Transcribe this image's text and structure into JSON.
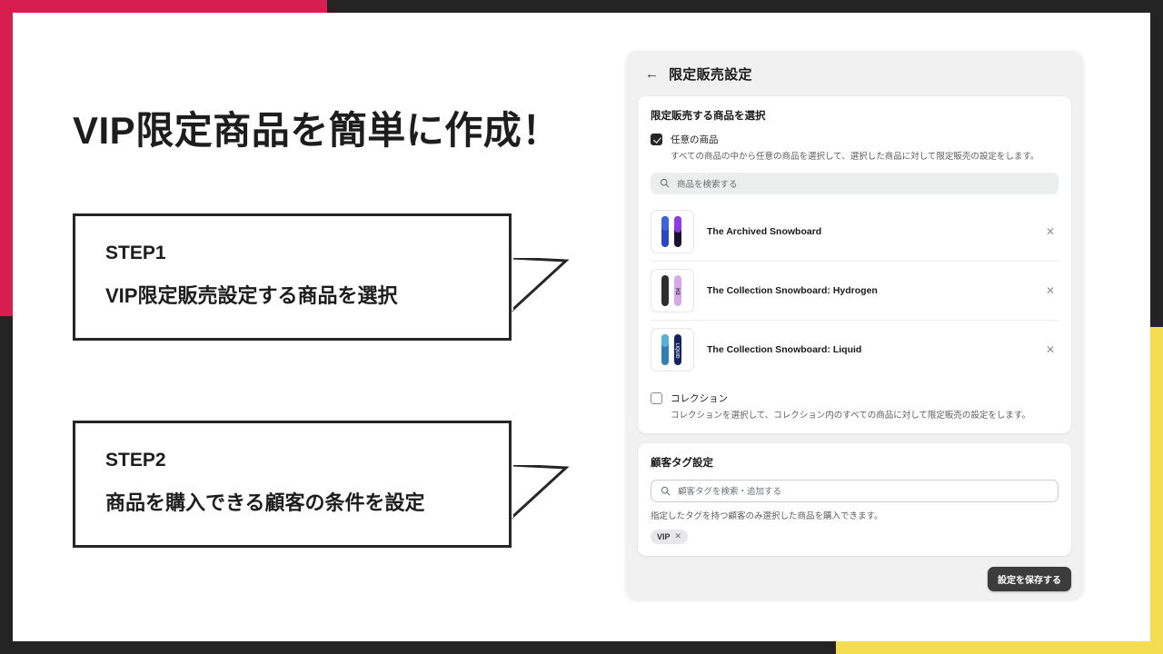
{
  "slide": {
    "headline": "VIP限定商品を簡単に作成！",
    "colors": {
      "accent_red": "#d81e4e",
      "accent_yellow": "#f5dd52",
      "frame_dark": "#242424",
      "text_dark": "#1d1d1d"
    },
    "steps": [
      {
        "number": "STEP1",
        "text": "VIP限定販売設定する商品を選択"
      },
      {
        "number": "STEP2",
        "text": "商品を購入できる顧客の条件を設定"
      }
    ]
  },
  "app": {
    "header": {
      "back_icon": "arrow-left-icon",
      "title": "限定販売設定"
    },
    "products_card": {
      "title": "限定販売する商品を選択",
      "any_product": {
        "label": "任意の商品",
        "checked": true,
        "help": "すべての商品の中から任意の商品を選択して、選択した商品に対して限定販売の設定をします。"
      },
      "search": {
        "icon": "search-icon",
        "placeholder": "商品を検索する",
        "value": ""
      },
      "items": [
        {
          "name": "The Archived Snowboard",
          "remove_icon": "close-icon"
        },
        {
          "name": "The Collection Snowboard: Hydrogen",
          "remove_icon": "close-icon"
        },
        {
          "name": "The Collection Snowboard: Liquid",
          "remove_icon": "close-icon"
        }
      ],
      "collection": {
        "label": "コレクション",
        "checked": false,
        "help": "コレクションを選択して、コレクション内のすべての商品に対して限定販売の設定をします。"
      }
    },
    "tags_card": {
      "title": "顧客タグ設定",
      "search": {
        "icon": "search-icon",
        "placeholder": "顧客タグを検索・追加する",
        "value": ""
      },
      "help": "指定したタグを持つ顧客のみ選択した商品を購入できます。",
      "chips": [
        {
          "label": "VIP",
          "remove_icon": "close-icon"
        }
      ]
    },
    "save_button": "設定を保存する"
  }
}
